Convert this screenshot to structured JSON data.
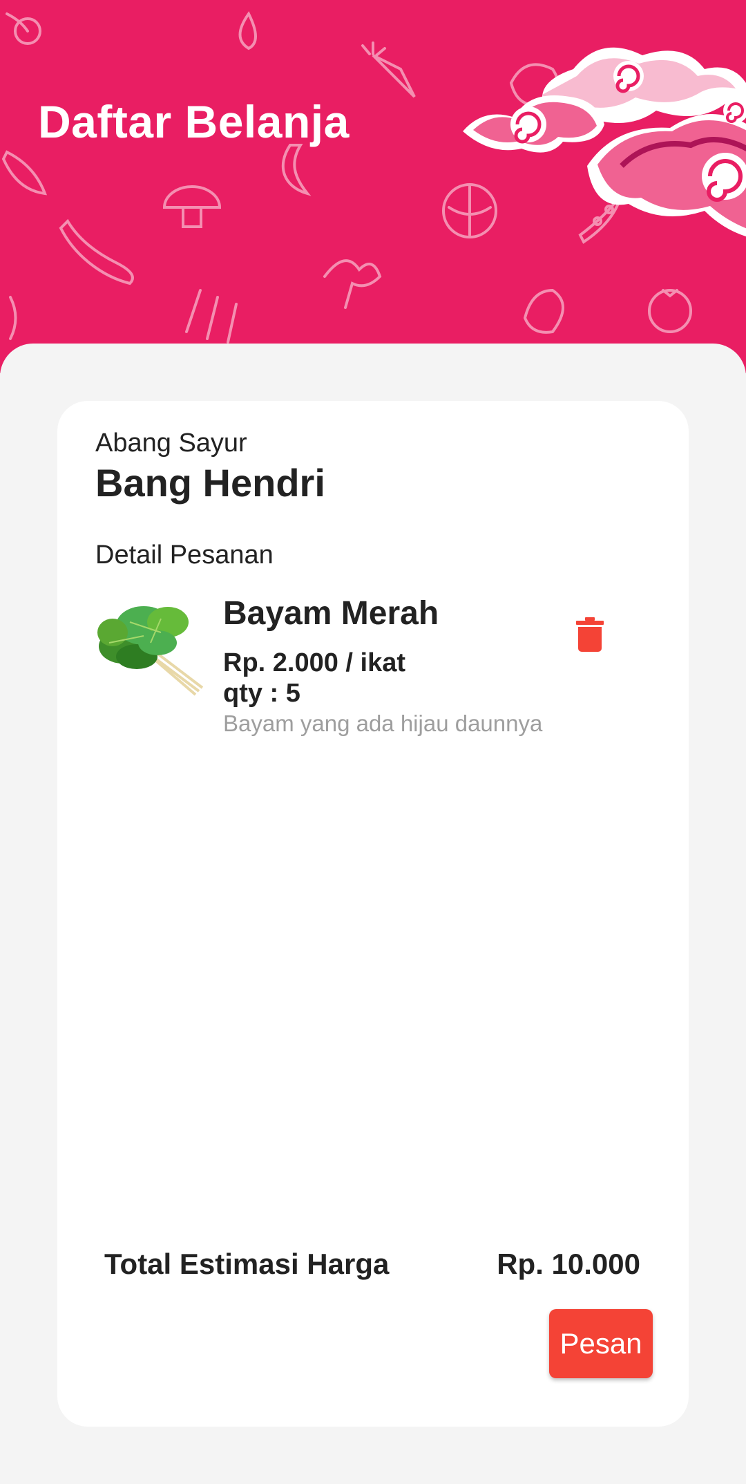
{
  "header": {
    "title": "Daftar Belanja",
    "background_color": "#e91e63",
    "decoration_icons": [
      "vegetable-pattern-icons",
      "cloud-ornament-icon"
    ]
  },
  "order": {
    "vendor_label": "Abang Sayur",
    "vendor_name": "Bang Hendri",
    "section_label": "Detail Pesanan",
    "items": [
      {
        "name": "Bayam Merah",
        "price": "Rp. 2.000 / ikat",
        "qty": "qty : 5",
        "description": "Bayam yang ada hijau daunnya",
        "image_icon": "spinach-image",
        "delete_icon": "trash-icon"
      }
    ],
    "total_label": "Total Estimasi Harga",
    "total_value": "Rp. 10.000",
    "order_button": "Pesan",
    "accent_color": "#f44336"
  }
}
